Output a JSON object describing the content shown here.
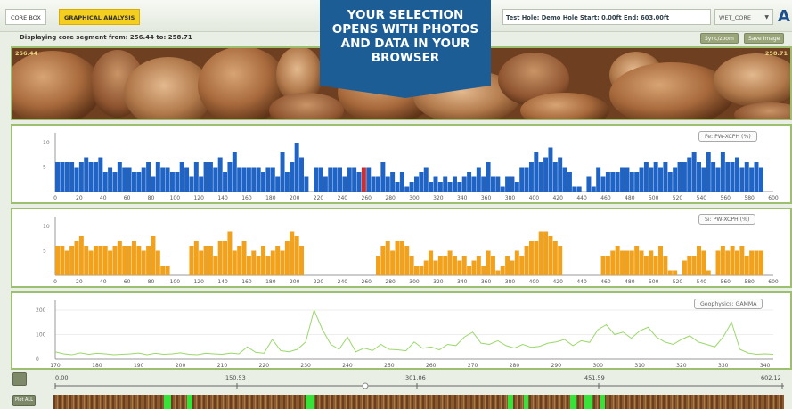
{
  "tabs": [
    {
      "label": "CORE BOX"
    },
    {
      "label": "GRAPHICAL ANALYSIS"
    }
  ],
  "hole_info": "Test Hole: Demo Hole Start: 0.00ft End: 603.00ft",
  "dropdown": {
    "value": "WET_CORE",
    "arrow": "▼"
  },
  "logo": "A",
  "banner": {
    "lines": [
      "YOUR SELECTION",
      "OPENS WITH PHOTOS",
      "AND DATA IN YOUR",
      "BROWSER"
    ],
    "color": "#1c5d95"
  },
  "display": {
    "label": "Displaying core segment from:",
    "from": "256.44",
    "to_label": "to:",
    "to": "258.71"
  },
  "buttons": {
    "sync": "Sync/zoom",
    "save": "Save Image"
  },
  "photo": {
    "left_depth": "256.44",
    "right_depth": "258.71"
  },
  "panels": {
    "fe": {
      "legend": "Fe: PW-XCPH (%)",
      "color": "#1f63c4",
      "highlight_color": "#d22c2c",
      "y_ticks": [
        "10",
        "5"
      ],
      "x_ticks": [
        "0",
        "20",
        "40",
        "60",
        "80",
        "100",
        "120",
        "140",
        "160",
        "180",
        "200",
        "220",
        "240",
        "260",
        "280",
        "300",
        "320",
        "340",
        "360",
        "380",
        "400",
        "420",
        "440",
        "460",
        "480",
        "500",
        "520",
        "540",
        "560",
        "580",
        "600"
      ]
    },
    "si": {
      "legend": "Si: PW-XCPH (%)",
      "color": "#f1a11b",
      "y_ticks": [
        "10",
        "5"
      ],
      "x_ticks": [
        "0",
        "20",
        "40",
        "60",
        "80",
        "100",
        "120",
        "140",
        "160",
        "180",
        "200",
        "220",
        "240",
        "260",
        "280",
        "300",
        "320",
        "340",
        "360",
        "380",
        "400",
        "420",
        "440",
        "460",
        "480",
        "500",
        "520",
        "540",
        "560",
        "580",
        "600"
      ]
    },
    "gamma": {
      "legend": "Geophysics: GAMMA",
      "color": "#9ad86a",
      "y_ticks": [
        "200",
        "100",
        "0"
      ],
      "x_ticks": [
        "170",
        "180",
        "190",
        "200",
        "210",
        "220",
        "230",
        "240",
        "250",
        "260",
        "270",
        "280",
        "290",
        "300",
        "310",
        "320",
        "330",
        "340"
      ]
    }
  },
  "chart_data": [
    {
      "type": "bar",
      "title": "",
      "legend": "Fe: PW-XCPH (%)",
      "xlim": [
        0,
        600
      ],
      "ylim": [
        0,
        12
      ],
      "x": [
        0,
        4,
        8,
        12,
        16,
        20,
        24,
        28,
        32,
        36,
        40,
        44,
        48,
        52,
        56,
        60,
        64,
        68,
        72,
        76,
        80,
        84,
        88,
        92,
        96,
        100,
        104,
        108,
        112,
        116,
        120,
        124,
        128,
        132,
        136,
        140,
        144,
        148,
        152,
        156,
        160,
        164,
        168,
        172,
        176,
        180,
        184,
        188,
        192,
        196,
        200,
        204,
        208,
        212,
        216,
        220,
        224,
        228,
        232,
        236,
        240,
        244,
        248,
        252,
        256,
        260,
        264,
        268,
        272,
        276,
        280,
        284,
        288,
        292,
        296,
        300,
        304,
        308,
        312,
        316,
        320,
        324,
        328,
        332,
        336,
        340,
        344,
        348,
        352,
        356,
        360,
        364,
        368,
        372,
        376,
        380,
        384,
        388,
        392,
        396,
        400,
        404,
        408,
        412,
        416,
        420,
        424,
        428,
        432,
        436,
        440,
        444,
        448,
        452,
        456,
        460,
        464,
        468,
        472,
        476,
        480,
        484,
        488,
        492,
        496,
        500,
        504,
        508,
        512,
        516,
        520,
        524,
        528,
        532,
        536,
        540,
        544,
        548,
        552,
        556,
        560,
        564,
        568,
        572,
        576,
        580,
        584,
        588
      ],
      "values": [
        6,
        6,
        6,
        6,
        5,
        6,
        7,
        6,
        6,
        7,
        4,
        5,
        4,
        6,
        5,
        5,
        4,
        4,
        5,
        6,
        3,
        6,
        5,
        5,
        4,
        4,
        6,
        5,
        3,
        6,
        3,
        6,
        6,
        5,
        7,
        4,
        6,
        8,
        5,
        5,
        5,
        5,
        5,
        4,
        5,
        5,
        3,
        8,
        4,
        6,
        10,
        7,
        3,
        0,
        5,
        5,
        3,
        5,
        5,
        5,
        3,
        5,
        5,
        4,
        5,
        5,
        3,
        3,
        6,
        3,
        4,
        2,
        4,
        1,
        2,
        3,
        4,
        5,
        2,
        3,
        2,
        3,
        2,
        3,
        2,
        3,
        4,
        3,
        5,
        3,
        6,
        3,
        3,
        1,
        3,
        3,
        2,
        5,
        5,
        6,
        8,
        6,
        7,
        9,
        6,
        7,
        5,
        4,
        1,
        1,
        0,
        3,
        1,
        5,
        3,
        4,
        4,
        4,
        5,
        5,
        4,
        4,
        5,
        6,
        5,
        6,
        5,
        6,
        4,
        5,
        6,
        6,
        7,
        8,
        6,
        5,
        8,
        6,
        5,
        8,
        6,
        6,
        7,
        5,
        6,
        5,
        6,
        5
      ],
      "highlight_index": 64
    },
    {
      "type": "bar",
      "title": "",
      "legend": "Si: PW-XCPH (%)",
      "xlim": [
        0,
        600
      ],
      "ylim": [
        0,
        12
      ],
      "x": [
        0,
        4,
        8,
        12,
        16,
        20,
        24,
        28,
        32,
        36,
        40,
        44,
        48,
        52,
        56,
        60,
        64,
        68,
        72,
        76,
        80,
        84,
        88,
        92,
        96,
        100,
        104,
        108,
        112,
        116,
        120,
        124,
        128,
        132,
        136,
        140,
        144,
        148,
        152,
        156,
        160,
        164,
        168,
        172,
        176,
        180,
        184,
        188,
        192,
        196,
        200,
        204,
        208,
        212,
        216,
        220,
        224,
        228,
        232,
        236,
        240,
        244,
        248,
        252,
        256,
        260,
        264,
        268,
        272,
        276,
        280,
        284,
        288,
        292,
        296,
        300,
        304,
        308,
        312,
        316,
        320,
        324,
        328,
        332,
        336,
        340,
        344,
        348,
        352,
        356,
        360,
        364,
        368,
        372,
        376,
        380,
        384,
        388,
        392,
        396,
        400,
        404,
        408,
        412,
        416,
        420,
        424,
        428,
        432,
        436,
        440,
        444,
        448,
        452,
        456,
        460,
        464,
        468,
        472,
        476,
        480,
        484,
        488,
        492,
        496,
        500,
        504,
        508,
        512,
        516,
        520,
        524,
        528,
        532,
        536,
        540,
        544,
        548,
        552,
        556,
        560,
        564,
        568,
        572,
        576,
        580,
        584,
        588
      ],
      "values": [
        6,
        6,
        5,
        6,
        7,
        8,
        6,
        5,
        6,
        6,
        6,
        5,
        6,
        7,
        6,
        6,
        7,
        6,
        5,
        6,
        8,
        5,
        2,
        2,
        0,
        0,
        0,
        0,
        6,
        7,
        5,
        6,
        6,
        4,
        7,
        7,
        9,
        5,
        6,
        7,
        4,
        5,
        4,
        6,
        4,
        5,
        6,
        5,
        7,
        9,
        8,
        6,
        0,
        0,
        0,
        0,
        0,
        0,
        0,
        0,
        0,
        0,
        0,
        0,
        0,
        0,
        0,
        4,
        6,
        7,
        5,
        7,
        7,
        6,
        4,
        2,
        2,
        3,
        5,
        3,
        4,
        4,
        5,
        4,
        3,
        4,
        2,
        3,
        4,
        2,
        5,
        4,
        1,
        2,
        4,
        3,
        5,
        4,
        6,
        7,
        7,
        9,
        9,
        8,
        7,
        6,
        0,
        0,
        0,
        0,
        0,
        0,
        0,
        0,
        4,
        4,
        5,
        6,
        5,
        5,
        5,
        6,
        5,
        4,
        5,
        4,
        6,
        4,
        1,
        1,
        0,
        3,
        4,
        4,
        6,
        5,
        1,
        0,
        5,
        6,
        5,
        6,
        5,
        6,
        4,
        5,
        5,
        5
      ],
      "highlight_index": -1
    },
    {
      "type": "line",
      "title": "",
      "legend": "Geophysics: GAMMA",
      "xlim": [
        170,
        342
      ],
      "ylim": [
        0,
        240
      ],
      "x": [
        170,
        172,
        174,
        176,
        178,
        180,
        182,
        184,
        186,
        188,
        190,
        192,
        194,
        196,
        198,
        200,
        202,
        204,
        206,
        208,
        210,
        212,
        214,
        216,
        218,
        220,
        222,
        224,
        226,
        228,
        230,
        232,
        234,
        236,
        238,
        240,
        242,
        244,
        246,
        248,
        250,
        252,
        254,
        256,
        258,
        260,
        262,
        264,
        266,
        268,
        270,
        272,
        274,
        276,
        278,
        280,
        282,
        284,
        286,
        288,
        290,
        292,
        294,
        296,
        298,
        300,
        302,
        304,
        306,
        308,
        310,
        312,
        314,
        316,
        318,
        320,
        322,
        324,
        326,
        328,
        330,
        332,
        334,
        336,
        338,
        340,
        342
      ],
      "values": [
        30,
        22,
        18,
        26,
        20,
        24,
        22,
        18,
        20,
        22,
        25,
        18,
        24,
        20,
        22,
        26,
        20,
        18,
        24,
        22,
        20,
        25,
        22,
        50,
        28,
        24,
        80,
        35,
        30,
        40,
        70,
        200,
        120,
        60,
        40,
        90,
        30,
        45,
        35,
        60,
        40,
        38,
        34,
        70,
        44,
        50,
        38,
        60,
        55,
        90,
        110,
        65,
        60,
        75,
        55,
        45,
        60,
        48,
        52,
        65,
        70,
        80,
        55,
        75,
        68,
        120,
        140,
        100,
        110,
        85,
        115,
        130,
        90,
        70,
        60,
        80,
        95,
        70,
        60,
        50,
        90,
        150,
        40,
        25,
        20,
        22,
        20
      ]
    }
  ],
  "scale": {
    "ticks": [
      "0.00",
      "150.53",
      "301.06",
      "451.59",
      "602.12"
    ]
  },
  "side_buttons": {
    "plot_all": "Plot ALL"
  }
}
